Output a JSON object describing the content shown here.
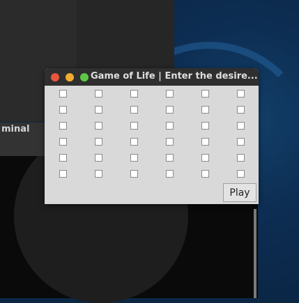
{
  "desktop": {
    "terminal_label": "minal"
  },
  "window": {
    "title": "Game of Life | Enter the desire...",
    "controls": [
      "close",
      "minimize",
      "maximize"
    ],
    "grid": {
      "rows": 6,
      "cols": 6,
      "checked": []
    },
    "play_label": "Play"
  },
  "colors": {
    "titlebar": "#2f2f2f",
    "window_bg": "#d9d9d9",
    "close": "#e9553d",
    "minimize": "#f3ac2f",
    "maximize": "#5ec844"
  }
}
